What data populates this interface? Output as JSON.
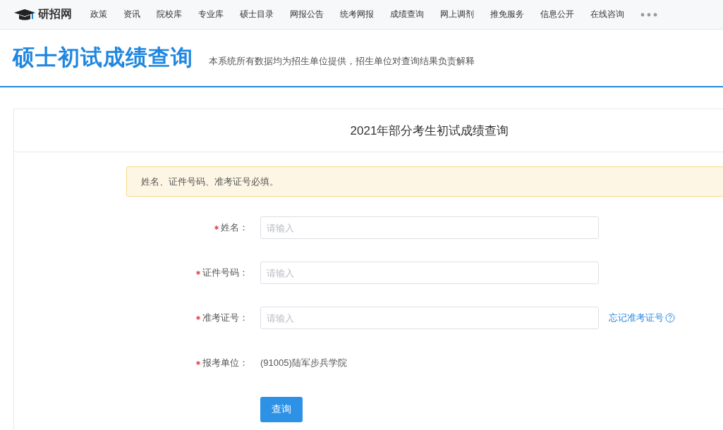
{
  "nav": {
    "logo": "研招网",
    "items": [
      "政策",
      "资讯",
      "院校库",
      "专业库",
      "硕士目录",
      "网报公告",
      "统考网报",
      "成绩查询",
      "网上调剂",
      "推免服务",
      "信息公开",
      "在线咨询"
    ]
  },
  "header": {
    "title": "硕士初试成绩查询",
    "subtitle": "本系统所有数据均为招生单位提供，招生单位对查询结果负责解释"
  },
  "card": {
    "title": "2021年部分考生初试成绩查询",
    "notice": "姓名、证件号码、准考证号必填。",
    "fields": [
      {
        "kind": "input",
        "label": "姓名：",
        "required": true,
        "placeholder": "请输入"
      },
      {
        "kind": "input",
        "label": "证件号码：",
        "required": true,
        "placeholder": "请输入"
      },
      {
        "kind": "input",
        "label": "准考证号：",
        "required": true,
        "placeholder": "请输入",
        "link": "忘记准考证号"
      },
      {
        "kind": "text",
        "label": "报考单位：",
        "required": true,
        "value": "(91005)陆军步兵学院"
      }
    ],
    "submit": "查询"
  }
}
